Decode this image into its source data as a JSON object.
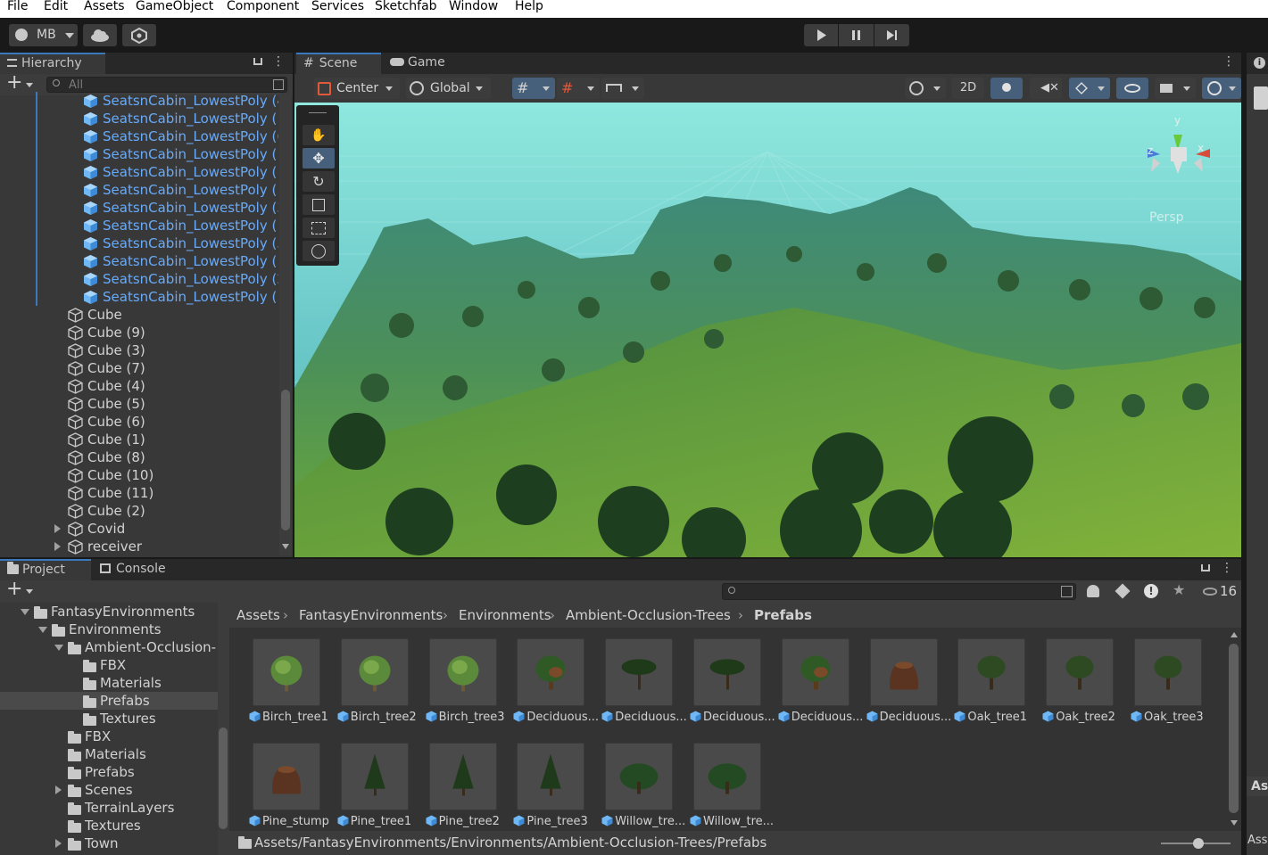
{
  "menu": [
    "File",
    "Edit",
    "Assets",
    "GameObject",
    "Component",
    "Services",
    "Sketchfab",
    "Window",
    "Help"
  ],
  "toolbar": {
    "account": "MB"
  },
  "hierarchy": {
    "tab": "Hierarchy",
    "search_placeholder": "All",
    "rows": [
      {
        "label": "SeatsnCabin_LowestPoly (4",
        "selected": true,
        "indent": 1
      },
      {
        "label": "SeatsnCabin_LowestPoly (",
        "selected": true,
        "indent": 1
      },
      {
        "label": "SeatsnCabin_LowestPoly (6",
        "selected": true,
        "indent": 1
      },
      {
        "label": "SeatsnCabin_LowestPoly (",
        "selected": true,
        "indent": 1
      },
      {
        "label": "SeatsnCabin_LowestPoly (",
        "selected": true,
        "indent": 1
      },
      {
        "label": "SeatsnCabin_LowestPoly (",
        "selected": true,
        "indent": 1
      },
      {
        "label": "SeatsnCabin_LowestPoly (3",
        "selected": true,
        "indent": 1
      },
      {
        "label": "SeatsnCabin_LowestPoly (",
        "selected": true,
        "indent": 1
      },
      {
        "label": "SeatsnCabin_LowestPoly (5",
        "selected": true,
        "indent": 1
      },
      {
        "label": "SeatsnCabin_LowestPoly (",
        "selected": true,
        "indent": 1
      },
      {
        "label": "SeatsnCabin_LowestPoly (2",
        "selected": true,
        "indent": 1
      },
      {
        "label": "SeatsnCabin_LowestPoly (",
        "selected": true,
        "indent": 1
      },
      {
        "label": "Cube",
        "selected": false,
        "indent": 0
      },
      {
        "label": "Cube (9)",
        "selected": false,
        "indent": 0
      },
      {
        "label": "Cube (3)",
        "selected": false,
        "indent": 0
      },
      {
        "label": "Cube (7)",
        "selected": false,
        "indent": 0
      },
      {
        "label": "Cube (4)",
        "selected": false,
        "indent": 0
      },
      {
        "label": "Cube (5)",
        "selected": false,
        "indent": 0
      },
      {
        "label": "Cube (6)",
        "selected": false,
        "indent": 0
      },
      {
        "label": "Cube (1)",
        "selected": false,
        "indent": 0
      },
      {
        "label": "Cube (8)",
        "selected": false,
        "indent": 0
      },
      {
        "label": "Cube (10)",
        "selected": false,
        "indent": 0
      },
      {
        "label": "Cube (11)",
        "selected": false,
        "indent": 0
      },
      {
        "label": "Cube (2)",
        "selected": false,
        "indent": 0
      },
      {
        "label": "Covid",
        "selected": false,
        "indent": 0,
        "expandable": true
      },
      {
        "label": "receiver",
        "selected": false,
        "indent": 0,
        "expandable": true
      }
    ]
  },
  "scene": {
    "tabs": [
      "Scene",
      "Game"
    ],
    "pivot": "Center",
    "space": "Global",
    "mode2d": "2D",
    "gizmo_label": "Persp",
    "axes": {
      "y": "y",
      "x": "x",
      "z": "z"
    }
  },
  "project": {
    "tabs": [
      "Project",
      "Console"
    ],
    "hidden_count": "16",
    "tree": [
      {
        "label": "FantasyEnvironments",
        "level": 0,
        "arrow": "down"
      },
      {
        "label": "Environments",
        "level": 1,
        "arrow": "down"
      },
      {
        "label": "Ambient-Occlusion-",
        "level": 2,
        "arrow": "down"
      },
      {
        "label": "FBX",
        "level": 3
      },
      {
        "label": "Materials",
        "level": 3
      },
      {
        "label": "Prefabs",
        "level": 3,
        "selected": true
      },
      {
        "label": "Textures",
        "level": 3
      },
      {
        "label": "FBX",
        "level": 2
      },
      {
        "label": "Materials",
        "level": 2
      },
      {
        "label": "Prefabs",
        "level": 2
      },
      {
        "label": "Scenes",
        "level": 2,
        "arrow": "right"
      },
      {
        "label": "TerrainLayers",
        "level": 2
      },
      {
        "label": "Textures",
        "level": 2
      },
      {
        "label": "Town",
        "level": 2,
        "arrow": "right"
      }
    ],
    "breadcrumb": [
      "Assets",
      "FantasyEnvironments",
      "Environments",
      "Ambient-Occlusion-Trees",
      "Prefabs"
    ],
    "assets": [
      {
        "label": "Birch_tree1",
        "kind": "birch"
      },
      {
        "label": "Birch_tree2",
        "kind": "birch"
      },
      {
        "label": "Birch_tree3",
        "kind": "birch"
      },
      {
        "label": "Deciduous...",
        "kind": "decid"
      },
      {
        "label": "Deciduous...",
        "kind": "flat"
      },
      {
        "label": "Deciduous...",
        "kind": "flat"
      },
      {
        "label": "Deciduous...",
        "kind": "decid"
      },
      {
        "label": "Deciduous...",
        "kind": "stump"
      },
      {
        "label": "Oak_tree1",
        "kind": "oak"
      },
      {
        "label": "Oak_tree2",
        "kind": "oak"
      },
      {
        "label": "Oak_tree3",
        "kind": "oak"
      },
      {
        "label": "Pine_stump",
        "kind": "stump"
      },
      {
        "label": "Pine_tree1",
        "kind": "pine"
      },
      {
        "label": "Pine_tree2",
        "kind": "pine"
      },
      {
        "label": "Pine_tree3",
        "kind": "pine"
      },
      {
        "label": "Willow_tre...",
        "kind": "willow"
      },
      {
        "label": "Willow_tre...",
        "kind": "willow"
      }
    ],
    "status_path": "Assets/FantasyEnvironments/Environments/Ambient-Occlusion-Trees/Prefabs"
  },
  "inspector": {
    "label1": "As",
    "label2": "Ass"
  },
  "colors": {
    "selection_text": "#68aaf9",
    "active_tab_accent": "#3a79bb",
    "sky": "#8fe3dc",
    "terrain": "#5a9a3a"
  }
}
